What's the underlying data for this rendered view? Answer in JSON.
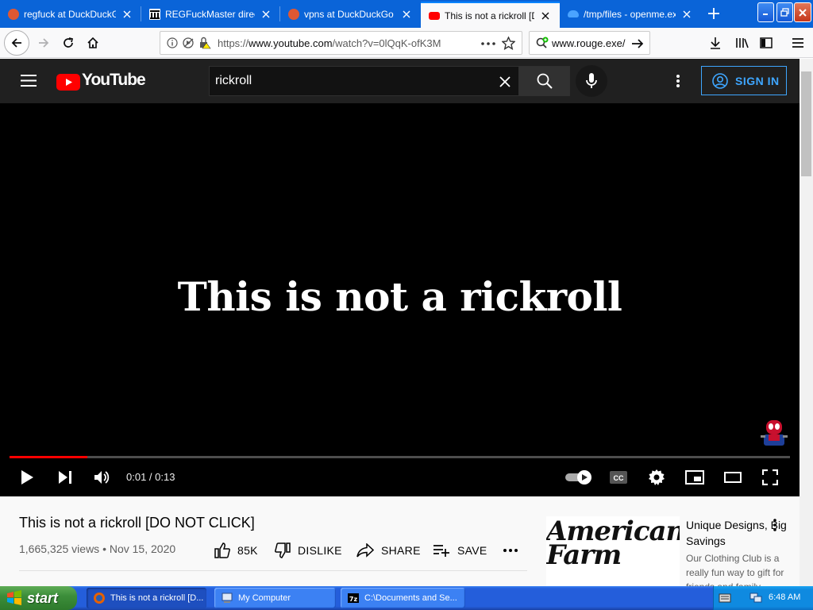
{
  "browser": {
    "tabs": [
      {
        "title": "regfuck at DuckDuckGo",
        "favicon": "duckduckgo-icon",
        "active": false
      },
      {
        "title": "REGFuckMaster director",
        "favicon": "archive-icon",
        "active": false
      },
      {
        "title": "vpns at DuckDuckGo",
        "favicon": "duckduckgo-icon",
        "active": false
      },
      {
        "title": "This is not a rickroll [DO",
        "favicon": "youtube-icon",
        "active": true
      },
      {
        "title": "/tmp/files - openme.exe",
        "favicon": "cloud-icon",
        "active": false
      }
    ],
    "url": "https://www.youtube.com/watch?v=0lQqK-ofK3M",
    "url_host": "www.youtube.com",
    "url_prefix": "https://",
    "url_suffix": "/watch?v=0lQqK-ofK3M",
    "search_value": "www.rouge.exe/"
  },
  "youtube": {
    "logo": "YouTube",
    "search_query": "rickroll",
    "sign_in": "SIGN IN",
    "video": {
      "overlay_text": "This is not a rickroll",
      "time": "0:01 / 0:13",
      "progress": 0.1
    },
    "title": "This is not a rickroll [DO NOT CLICK]",
    "views": "1,665,325 views",
    "date": "Nov 15, 2020",
    "meta": "1,665,325 views • Nov 15, 2020",
    "actions": {
      "like": "85K",
      "dislike": "DISLIKE",
      "share": "SHARE",
      "save": "SAVE"
    },
    "ad": {
      "image_text": "American Farm",
      "title": "Unique Designs, Big Savings",
      "description": "Our Clothing Club is a really fun way to gift for friends and family"
    }
  },
  "taskbar": {
    "start": "start",
    "tasks": [
      {
        "label": "This is not a rickroll [D...",
        "active": true
      },
      {
        "label": "My Computer",
        "active": false
      },
      {
        "label": "C:\\Documents and Se...",
        "active": false
      }
    ],
    "clock": "6:48 AM"
  },
  "colors": {
    "xp_blue": "#245edb",
    "yt_red": "#ff0000",
    "yt_dark": "#202020",
    "signin_blue": "#3ea6ff"
  }
}
